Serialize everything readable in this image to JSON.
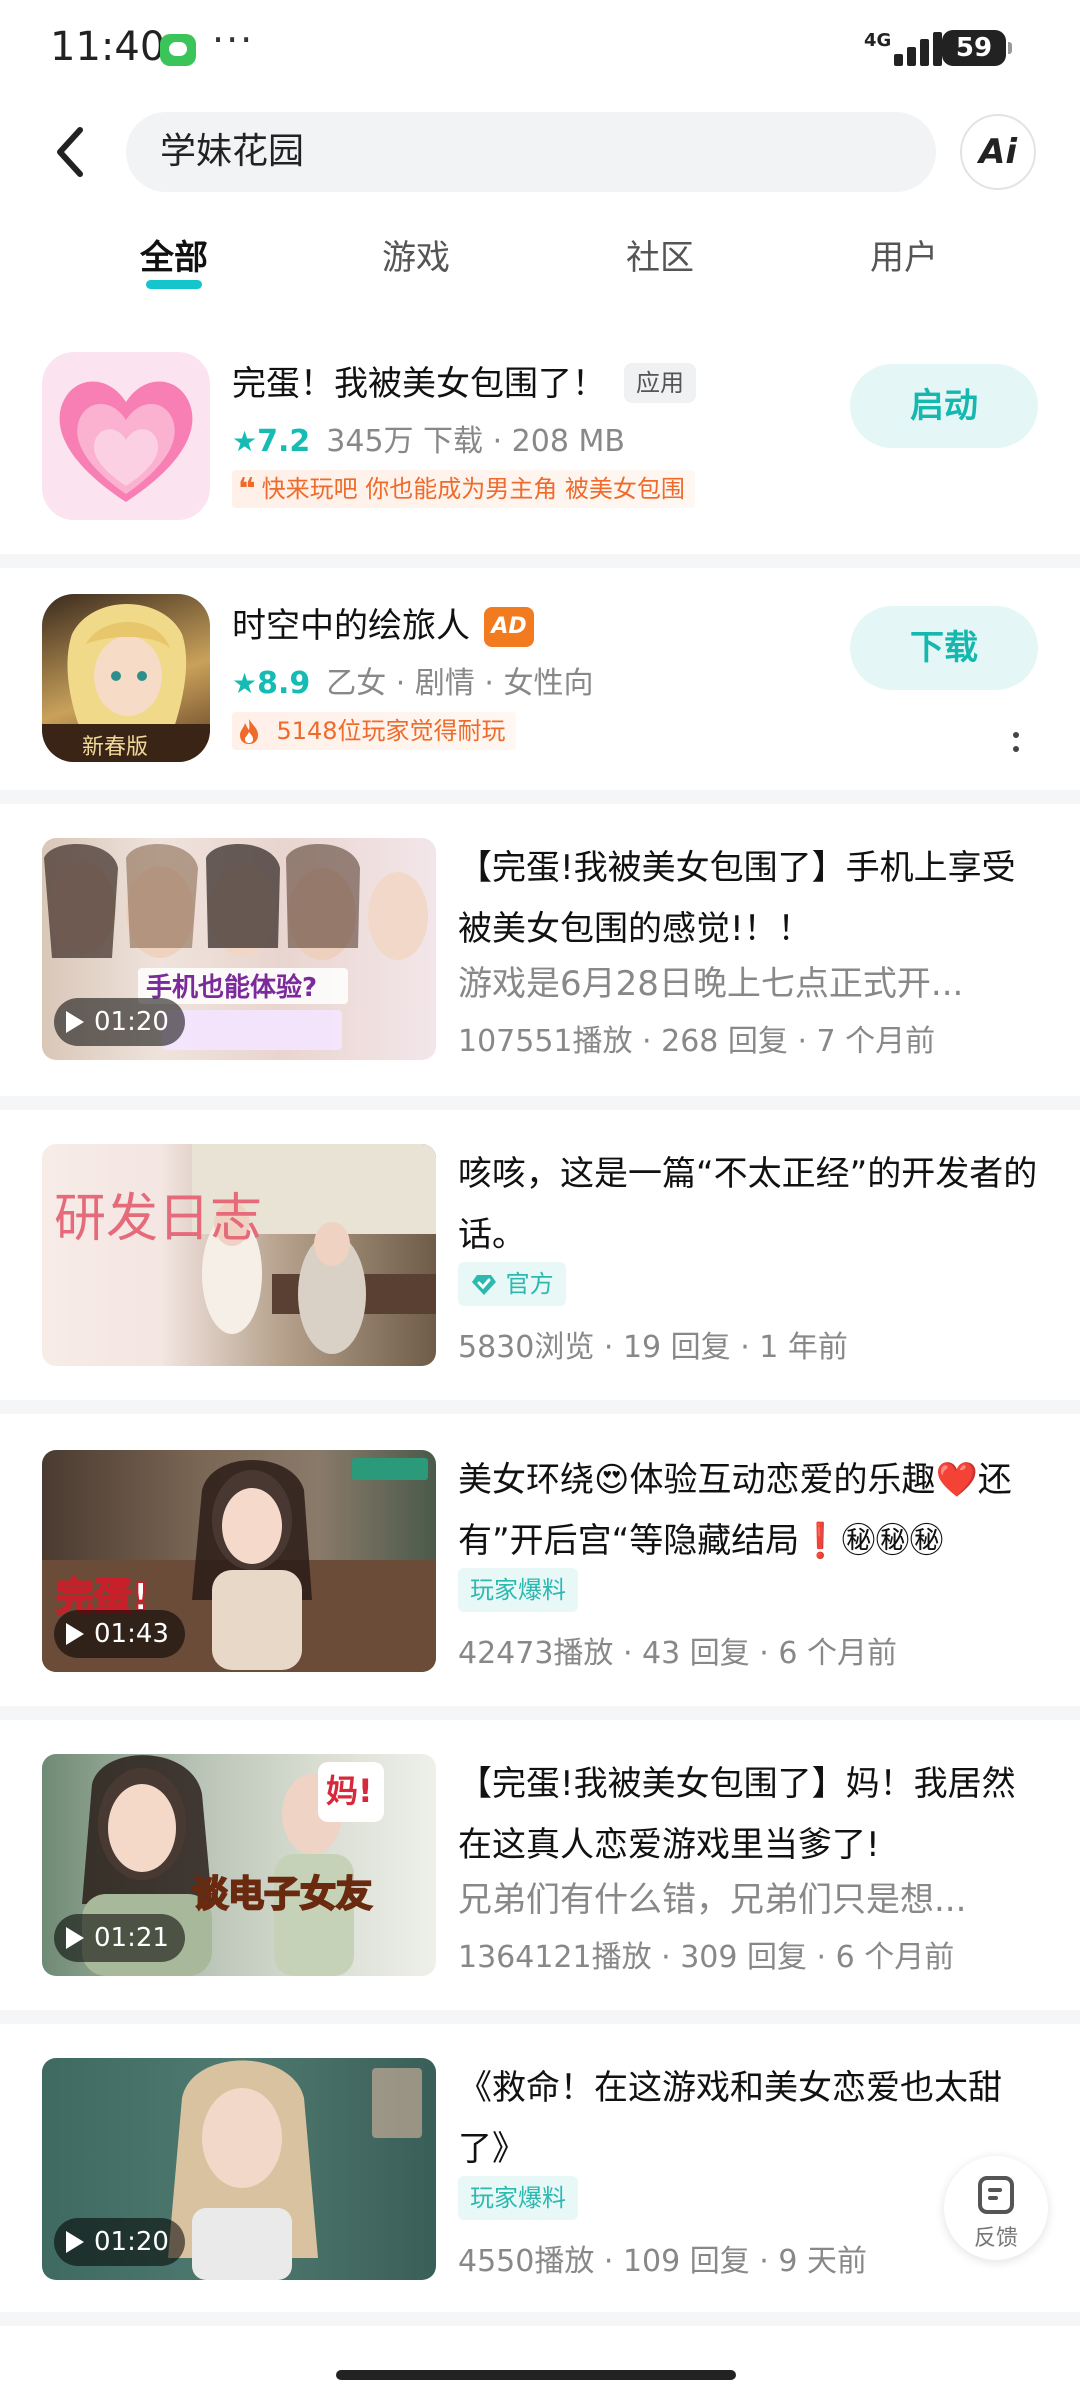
{
  "status_bar": {
    "time": "11:40",
    "network": "4G",
    "battery": "59"
  },
  "search": {
    "query": "学妹花园",
    "ai_label": "Ai"
  },
  "tabs": [
    {
      "label": "全部",
      "active": true
    },
    {
      "label": "游戏",
      "active": false
    },
    {
      "label": "社区",
      "active": false
    },
    {
      "label": "用户",
      "active": false
    }
  ],
  "apps": [
    {
      "title": "完蛋！我被美女包围了！",
      "tag": "应用",
      "rating": "7.2",
      "meta": "345万 下载 · 208 MB",
      "highlight": "快来玩吧 你也能成为男主角 被美女包围",
      "highlight_icon": "quote-icon",
      "action": "启动"
    },
    {
      "title": "时空中的绘旅人",
      "tag": "AD",
      "rating": "8.9",
      "meta": "乙女 · 剧情 · 女性向",
      "highlight": "5148位玩家觉得耐玩",
      "highlight_icon": "fire-icon",
      "action": "下载"
    }
  ],
  "posts": [
    {
      "title": "【完蛋!我被美女包围了】手机上享受被美女包围的感觉!！！",
      "excerpt": "游戏是6月28日晚上七点正式开...",
      "stats": "107551播放 · 268 回复 · 7 个月前",
      "duration": "01:20",
      "thumb_text": "手机也能体验?"
    },
    {
      "title": "咳咳，这是一篇“不太正经”的开发者的话。",
      "tag": "官方",
      "stats": "5830浏览 · 19 回复 · 1 年前",
      "thumb_text": "研发日志"
    },
    {
      "title": "美女环绕😍体验互动恋爱的乐趣❤️还有”开后宫“等隐藏结局❗㊙㊙㊙",
      "tag": "玩家爆料",
      "stats": "42473播放 · 43 回复 · 6 个月前",
      "duration": "01:43",
      "thumb_text": "完蛋!"
    },
    {
      "title": "【完蛋!我被美女包围了】妈！我居然在这真人恋爱游戏里当爹了!",
      "excerpt": "兄弟们有什么错，兄弟们只是想...",
      "stats": "1364121播放 · 309 回复 · 6 个月前",
      "duration": "01:21",
      "thumb_text": "谈电子女友"
    },
    {
      "title": "《救命！在这游戏和美女恋爱也太甜了》",
      "tag": "玩家爆料",
      "stats": "4550播放 · 109 回复 · 9 天前",
      "duration": "01:20"
    }
  ],
  "feedback": {
    "label": "反馈"
  },
  "colors": {
    "accent": "#16bcb4",
    "tab_underline": "#15c5ce",
    "ad_orange": "#f27b1f",
    "highlight_orange": "#ef6b2b"
  }
}
